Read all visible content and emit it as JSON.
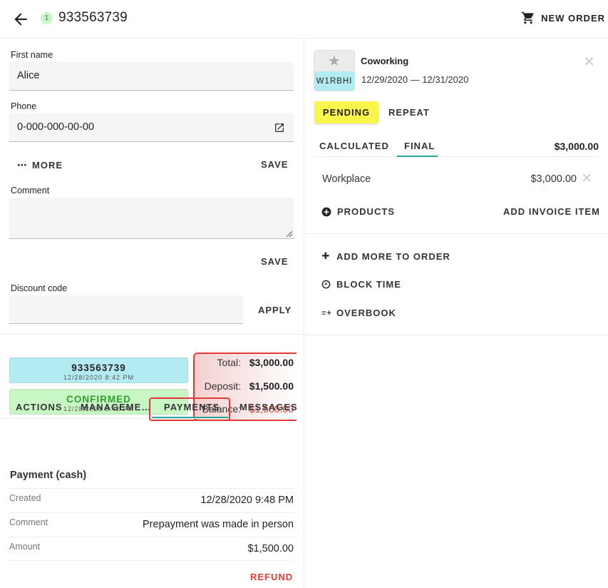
{
  "header": {
    "back_icon": "arrow-left-icon",
    "count": "1",
    "order_number": "933563739",
    "new_order_label": "NEW ORDER",
    "cart_icon": "cart-icon"
  },
  "form": {
    "first_name_label": "First name",
    "first_name_value": "Alice",
    "phone_label": "Phone",
    "phone_value": "0-000-000-00-00",
    "more_label": "MORE",
    "save_label": "SAVE",
    "comment_label": "Comment",
    "comment_save_label": "SAVE",
    "discount_label": "Discount code",
    "apply_label": "APPLY"
  },
  "status": {
    "order_number": "933563739",
    "order_date": "12/28/2020 8:42 PM",
    "state": "CONFIRMED",
    "state_date": "12/28/2020 8:42 PM",
    "colors": {
      "order_bg": "#b3ebf2",
      "confirmed_bg": "#c8f7c5",
      "confirmed_text": "#2e9e2e"
    }
  },
  "totals": {
    "total_label": "Total:",
    "total_value": "$3,000.00",
    "deposit_label": "Deposit:",
    "deposit_value": "$1,500.00",
    "balance_label": "Balance:",
    "balance_value": "$1,500.00"
  },
  "tabs": [
    "ACTIONS",
    "MANAGEME…",
    "PAYMENTS",
    "MESSAGES"
  ],
  "payment": {
    "title": "Payment (cash)",
    "rows": [
      {
        "label": "Created",
        "value": "12/28/2020 9:48 PM"
      },
      {
        "label": "Comment",
        "value": "Prepayment was made in person"
      },
      {
        "label": "Amount",
        "value": "$1,500.00"
      }
    ],
    "refund_label": "REFUND"
  },
  "service": {
    "name": "Coworking",
    "code": "W1RBHI",
    "dates": "12/29/2020 — 12/31/2020",
    "status_label": "PENDING",
    "repeat_label": "REPEAT",
    "price_tabs": [
      "CALCULATED",
      "FINAL"
    ],
    "price_total": "$3,000.00",
    "item_name": "Workplace",
    "item_price": "$3,000.00",
    "products_label": "PRODUCTS",
    "add_invoice_label": "ADD INVOICE ITEM"
  },
  "order_actions": [
    {
      "icon": "plus-icon",
      "label": "ADD MORE TO ORDER"
    },
    {
      "icon": "clock-icon",
      "label": "BLOCK TIME"
    },
    {
      "icon": "overbook-icon",
      "label": "OVERBOOK"
    }
  ]
}
